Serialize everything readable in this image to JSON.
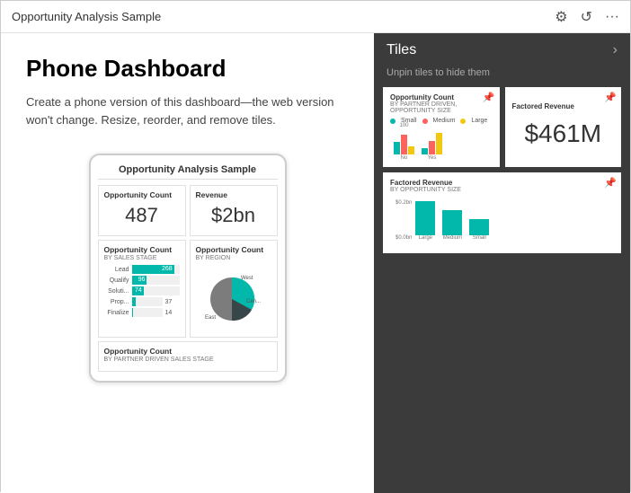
{
  "topbar": {
    "title": "Opportunity Analysis Sample",
    "icons": [
      "settings",
      "undo",
      "more"
    ]
  },
  "left": {
    "title": "Phone Dashboard",
    "description": "Create a phone version of this dashboard—the web version won't change. Resize, reorder, and remove tiles.",
    "phone": {
      "dashboard_title": "Opportunity Analysis Sample",
      "tile_count_label": "Opportunity Count",
      "tile_count_value": "487",
      "tile_revenue_label": "Revenue",
      "tile_revenue_value": "$2bn",
      "bar_chart_label": "Opportunity Count",
      "bar_chart_sub": "BY SALES STAGE",
      "bars": [
        {
          "label": "Lead",
          "value": 268,
          "max": 300,
          "display": "268"
        },
        {
          "label": "Qualify",
          "value": 96,
          "max": 300,
          "display": "96"
        },
        {
          "label": "Soluti...",
          "value": 74,
          "max": 300,
          "display": "74"
        },
        {
          "label": "Prop...",
          "value": 37,
          "max": 300,
          "outside": "37"
        },
        {
          "label": "Finalize",
          "value": 14,
          "max": 300,
          "outside": "14"
        }
      ],
      "region_label": "Opportunity Count",
      "region_sub": "BY REGION",
      "regions": [
        "West",
        "Cen...",
        "East"
      ],
      "bottom_label": "Opportunity Count",
      "bottom_sub": "BY PARTNER DRIVEN SALES STAGE"
    }
  },
  "right": {
    "title": "Tiles",
    "hint": "Unpin tiles to hide them",
    "arrow": "›",
    "tiles": [
      {
        "id": "opp-count-partner",
        "title": "Opportunity Count",
        "sub": "BY PARTNER DRIVEN, OPPORTUNITY SIZE",
        "type": "bar-chart",
        "legend": [
          {
            "color": "#01b8aa",
            "label": "Small"
          },
          {
            "color": "#fd625e",
            "label": "Medium"
          },
          {
            "color": "#f2c80f",
            "label": "Large"
          }
        ],
        "groups": [
          {
            "label": "No",
            "bars": [
              30,
              50,
              20
            ]
          },
          {
            "label": "Yes",
            "bars": [
              15,
              35,
              55
            ]
          }
        ]
      },
      {
        "id": "factored-revenue",
        "title": "Factored Revenue",
        "sub": "",
        "type": "big-value",
        "value": "$461M"
      },
      {
        "id": "factored-revenue-size",
        "title": "Factored Revenue",
        "sub": "BY OPPORTUNITY SIZE",
        "type": "bar-chart-single",
        "bars": [
          {
            "label": "Large",
            "height": 38,
            "color": "#01b8aa"
          },
          {
            "label": "Medium",
            "height": 28,
            "color": "#01b8aa"
          },
          {
            "label": "Small",
            "height": 18,
            "color": "#01b8aa"
          }
        ],
        "y_labels": [
          "$0.2bn",
          "$0.0bn"
        ]
      }
    ]
  }
}
